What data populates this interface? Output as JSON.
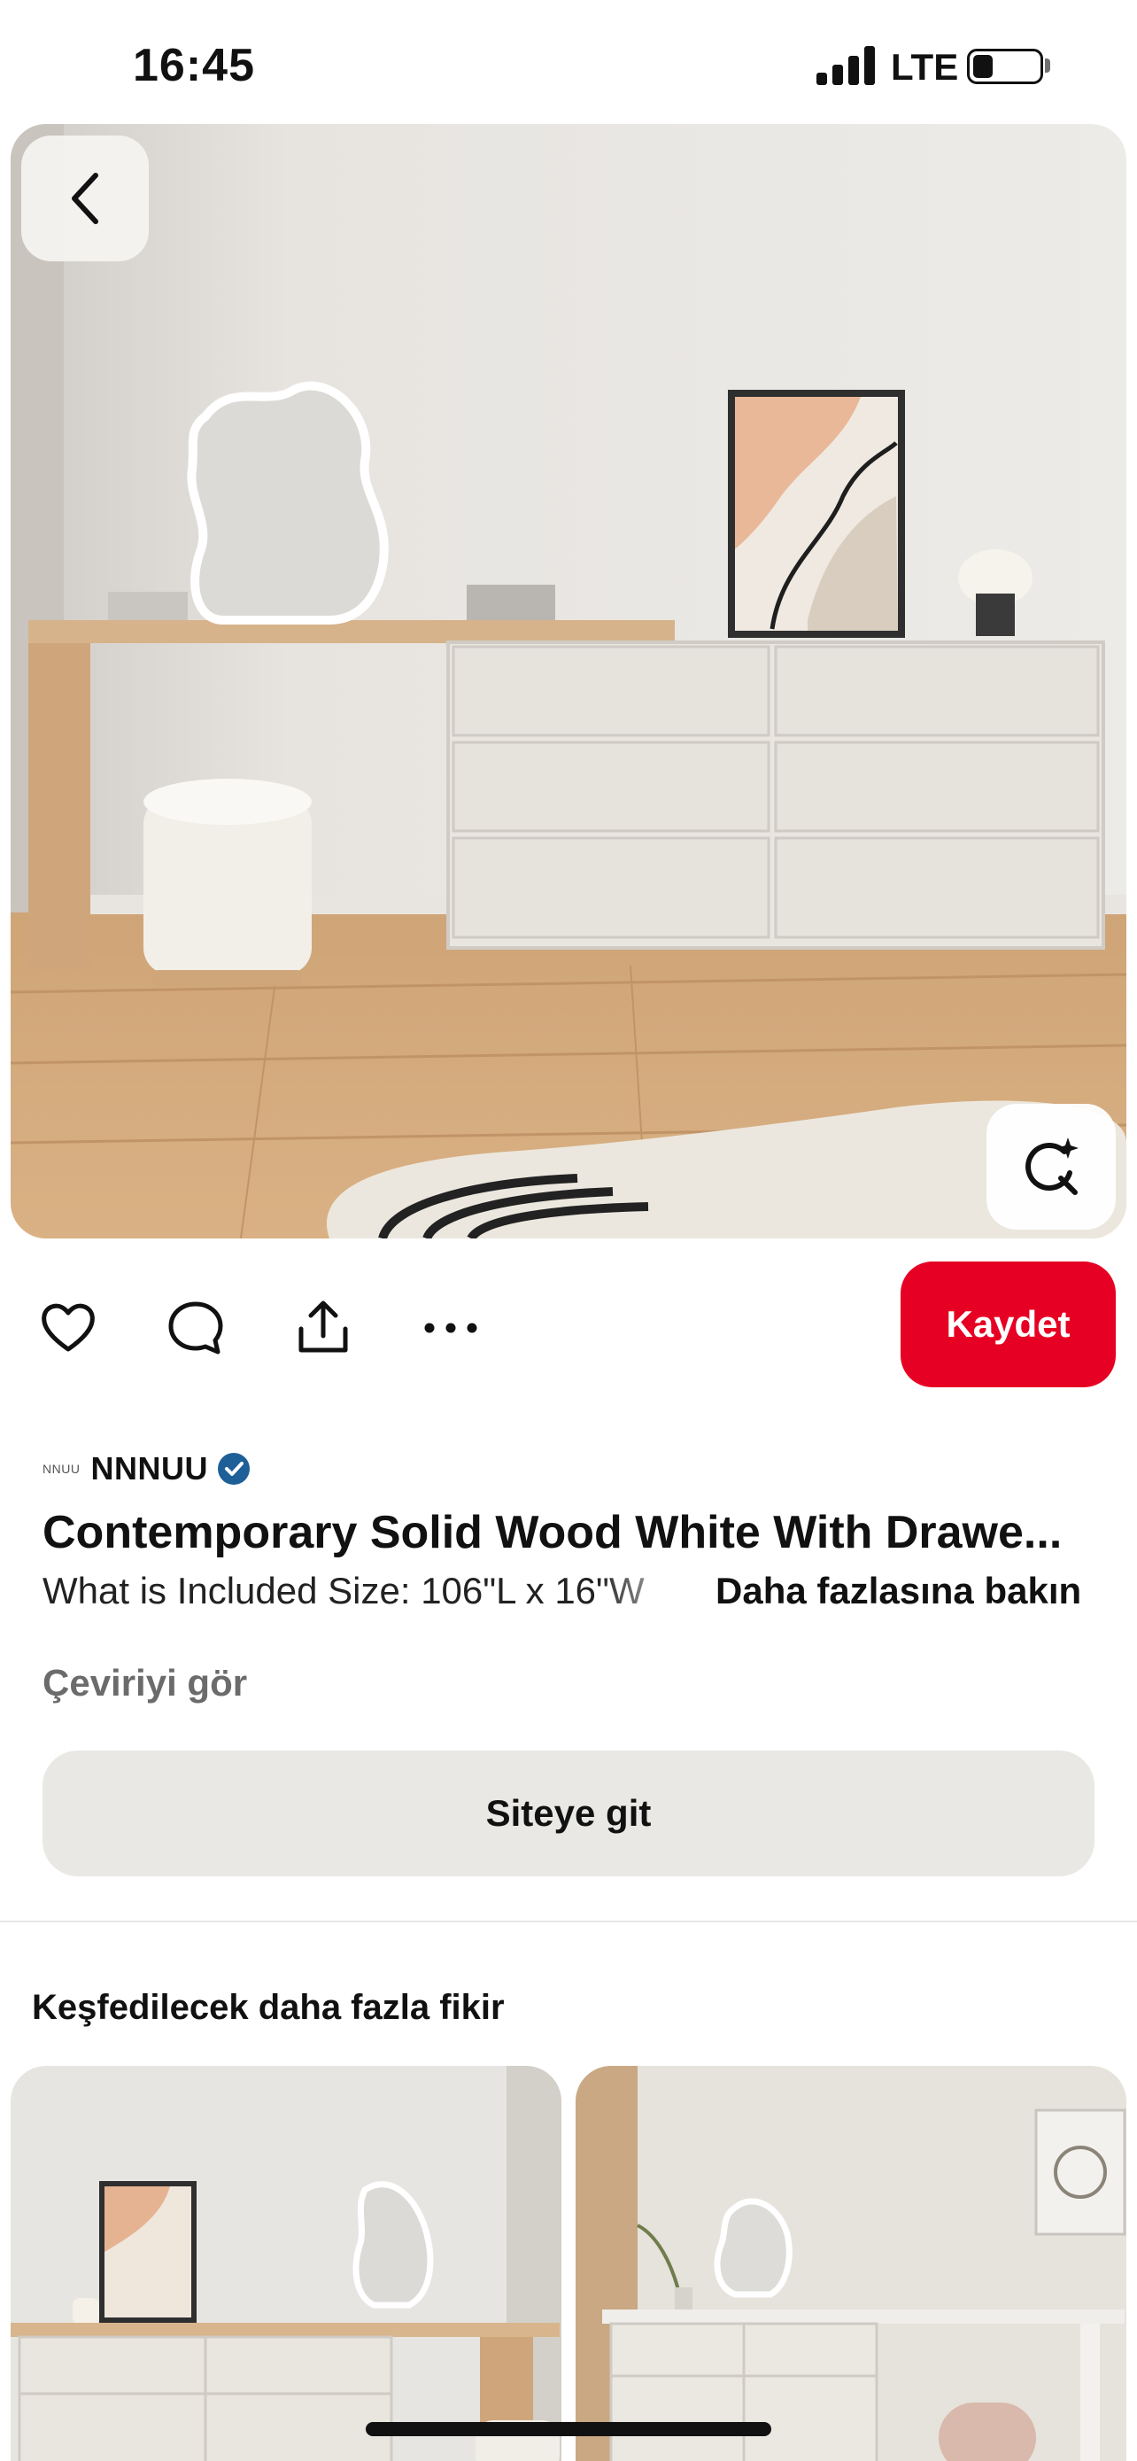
{
  "status_bar": {
    "time": "16:45",
    "network": "LTE",
    "battery_level": 0.2
  },
  "pin": {
    "creator_logo_text": "NNUU",
    "creator": "NNNUU",
    "title": "Contemporary Solid Wood White With Drawe...",
    "description": "What is Included Size: 106\"L x 16\"W",
    "more_link": "Daha fazlasına bakın",
    "translate": "Çeviriyi gör",
    "visit_button": "Siteye git"
  },
  "actions": {
    "save_label": "Kaydet",
    "icons": [
      "heart-icon",
      "comment-icon",
      "share-icon",
      "more-icon"
    ]
  },
  "explore": {
    "title": "Keşfedilecek daha fazla fikir"
  },
  "colors": {
    "accent": "#e60023",
    "verified": "#1f5f97",
    "button_bg": "#e9e8e4"
  }
}
